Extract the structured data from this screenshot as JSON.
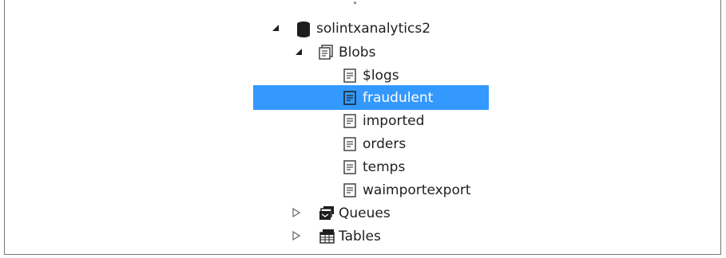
{
  "tree": {
    "account": {
      "label": "solintxanalytics2",
      "icon": "database-icon",
      "expanded": true
    },
    "blobs": {
      "label": "Blobs",
      "icon": "blob-folder-icon",
      "expanded": true,
      "containers": [
        {
          "label": "$logs",
          "icon": "container-icon",
          "selected": false
        },
        {
          "label": "fraudulent",
          "icon": "container-icon",
          "selected": true
        },
        {
          "label": "imported",
          "icon": "container-icon",
          "selected": false
        },
        {
          "label": "orders",
          "icon": "container-icon",
          "selected": false
        },
        {
          "label": "temps",
          "icon": "container-icon",
          "selected": false
        },
        {
          "label": "waimportexport",
          "icon": "container-icon",
          "selected": false
        }
      ]
    },
    "queues": {
      "label": "Queues",
      "icon": "queue-icon",
      "expanded": false
    },
    "tables": {
      "label": "Tables",
      "icon": "table-icon",
      "expanded": false
    }
  },
  "colors": {
    "selection": "#3399ff",
    "text": "#1e1e1e",
    "selected_text": "#ffffff",
    "border": "#777777"
  }
}
